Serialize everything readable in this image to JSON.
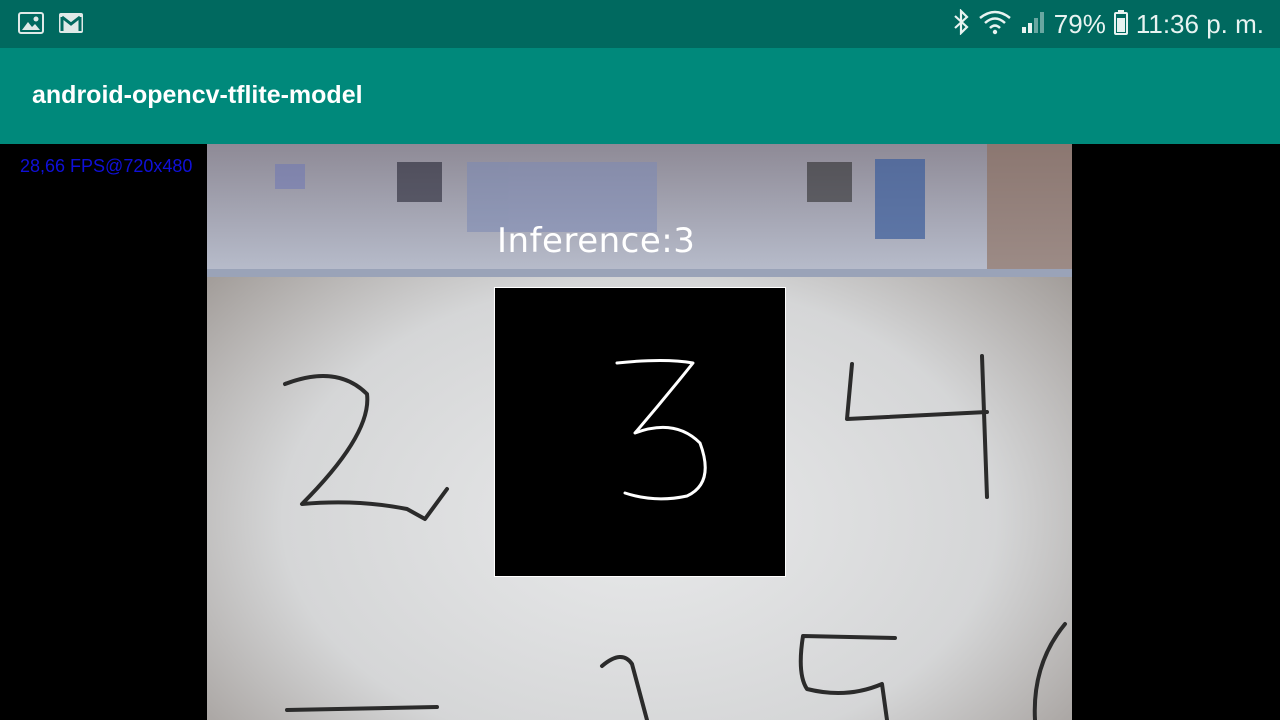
{
  "status_bar": {
    "battery_percent": "79%",
    "time": "11:36 p. m.",
    "icons": [
      "gallery-icon",
      "gmail-icon",
      "bluetooth-icon",
      "wifi-icon",
      "signal-icon",
      "battery-icon"
    ]
  },
  "app": {
    "title": "android-opencv-tflite-model",
    "accent_color": "#00897b",
    "status_color": "#00695f"
  },
  "camera": {
    "fps_label": "28,66 FPS@720x480",
    "inference_label": "Inference:3",
    "roi_digit": "3"
  }
}
